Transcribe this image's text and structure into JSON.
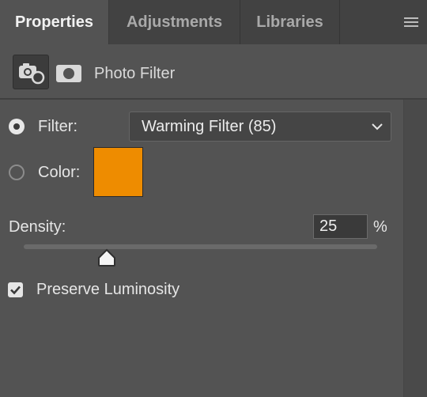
{
  "tabs": [
    {
      "label": "Properties",
      "active": true
    },
    {
      "label": "Adjustments",
      "active": false
    },
    {
      "label": "Libraries",
      "active": false
    }
  ],
  "header": {
    "title": "Photo Filter",
    "adjustment_icon": "camera-adjustment-icon",
    "mask_icon": "mask-icon"
  },
  "filter": {
    "radio_selected": true,
    "label": "Filter:",
    "selected": "Warming Filter (85)"
  },
  "color": {
    "radio_selected": false,
    "label": "Color:",
    "swatch": "#ee8c00"
  },
  "density": {
    "label": "Density:",
    "value": "25",
    "unit": "%"
  },
  "preserve_luminosity": {
    "label": "Preserve Luminosity",
    "checked": true
  }
}
